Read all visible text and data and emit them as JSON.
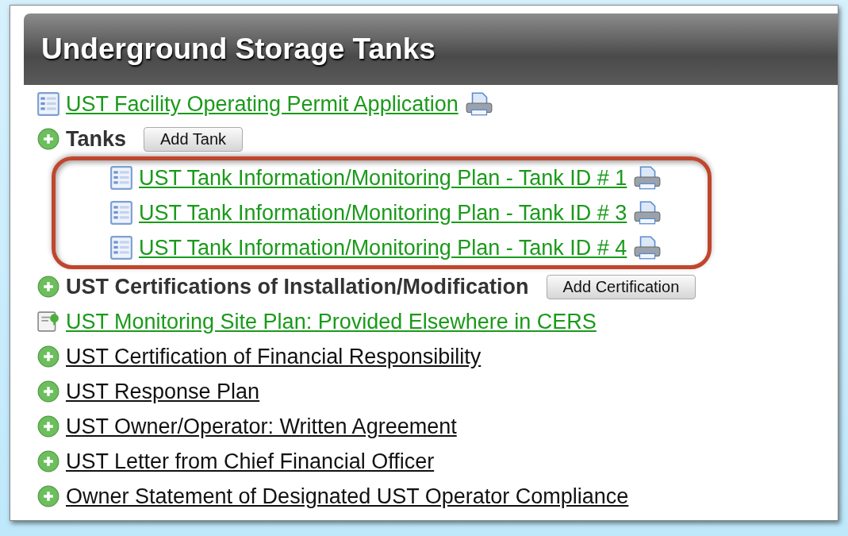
{
  "panel": {
    "title": "Underground Storage Tanks"
  },
  "items": [
    {
      "kind": "form",
      "label": "UST Facility Operating Permit Application"
    },
    {
      "kind": "section",
      "label": "Tanks",
      "button": "Add Tank",
      "highlighted": true,
      "children": [
        {
          "label": "UST Tank Information/Monitoring Plan - Tank ID # 1"
        },
        {
          "label": "UST Tank Information/Monitoring Plan - Tank ID # 3"
        },
        {
          "label": "UST Tank Information/Monitoring Plan - Tank ID # 4"
        }
      ]
    },
    {
      "kind": "section",
      "label": "UST Certifications of Installation/Modification",
      "button": "Add Certification"
    },
    {
      "kind": "document",
      "label": "UST Monitoring Site Plan: Provided Elsewhere in CERS"
    },
    {
      "kind": "link",
      "label": "UST Certification of Financial Responsibility"
    },
    {
      "kind": "link",
      "label": "UST Response Plan"
    },
    {
      "kind": "link",
      "label": "UST Owner/Operator: Written Agreement"
    },
    {
      "kind": "link",
      "label": "UST Letter from Chief Financial Officer"
    },
    {
      "kind": "link",
      "label": "Owner Statement of Designated UST Operator Compliance"
    }
  ]
}
